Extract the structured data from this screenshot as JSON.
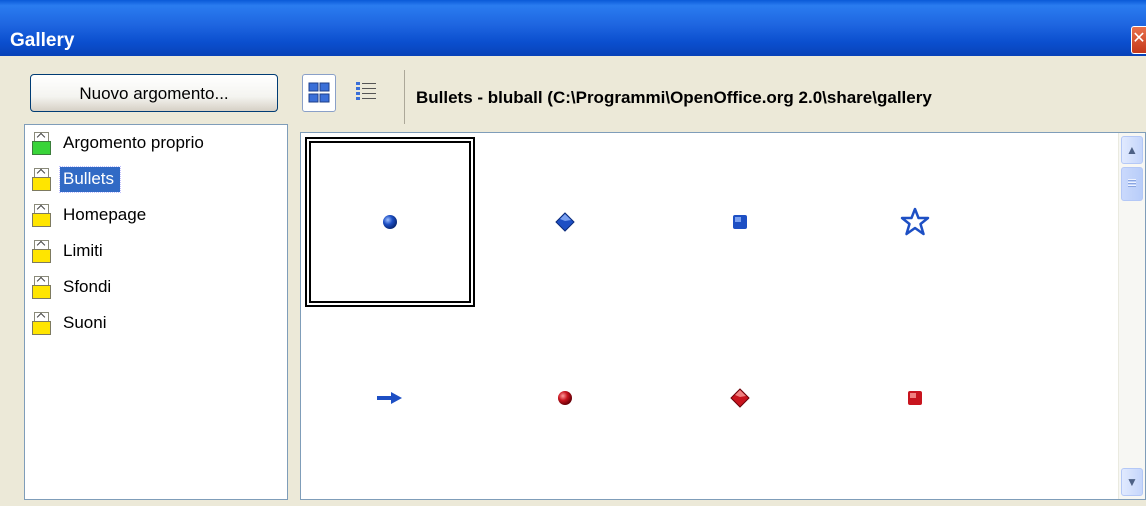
{
  "window": {
    "title": "Gallery",
    "close_icon": "close-icon"
  },
  "toolbar": {
    "new_topic_label": "Nuovo argomento...",
    "icon_view": "icon-view-icon",
    "detail_view": "detail-view-icon",
    "path": "Bullets - bluball (C:\\Programmi\\OpenOffice.org 2.0\\share\\gallery"
  },
  "topics": [
    {
      "label": "Argomento proprio",
      "icon": "green-folder-icon",
      "selected": false
    },
    {
      "label": "Bullets",
      "icon": "yellow-folder-icon",
      "selected": true
    },
    {
      "label": "Homepage",
      "icon": "yellow-folder-icon",
      "selected": false
    },
    {
      "label": "Limiti",
      "icon": "yellow-folder-icon",
      "selected": false
    },
    {
      "label": "Sfondi",
      "icon": "yellow-folder-icon",
      "selected": false
    },
    {
      "label": "Suoni",
      "icon": "yellow-folder-icon",
      "selected": false
    }
  ],
  "gallery_items": [
    {
      "name": "blue-ball-icon",
      "color": "#1d4fc4"
    },
    {
      "name": "blue-diamond-icon",
      "color": "#1d4fc4"
    },
    {
      "name": "blue-square-icon",
      "color": "#1d4fc4"
    },
    {
      "name": "blue-star-icon",
      "color": "#1d4fc4"
    },
    {
      "name": "blue-arrow-icon",
      "color": "#1d4fc4"
    },
    {
      "name": "red-ball-icon",
      "color": "#c8141e"
    },
    {
      "name": "red-diamond-icon",
      "color": "#c8141e"
    },
    {
      "name": "red-square-icon",
      "color": "#c8141e"
    }
  ],
  "colors": {
    "titlebar": "#0b4fcf",
    "selection": "#316ac5",
    "bullet_blue": "#1d4fc4",
    "bullet_red": "#c8141e"
  }
}
